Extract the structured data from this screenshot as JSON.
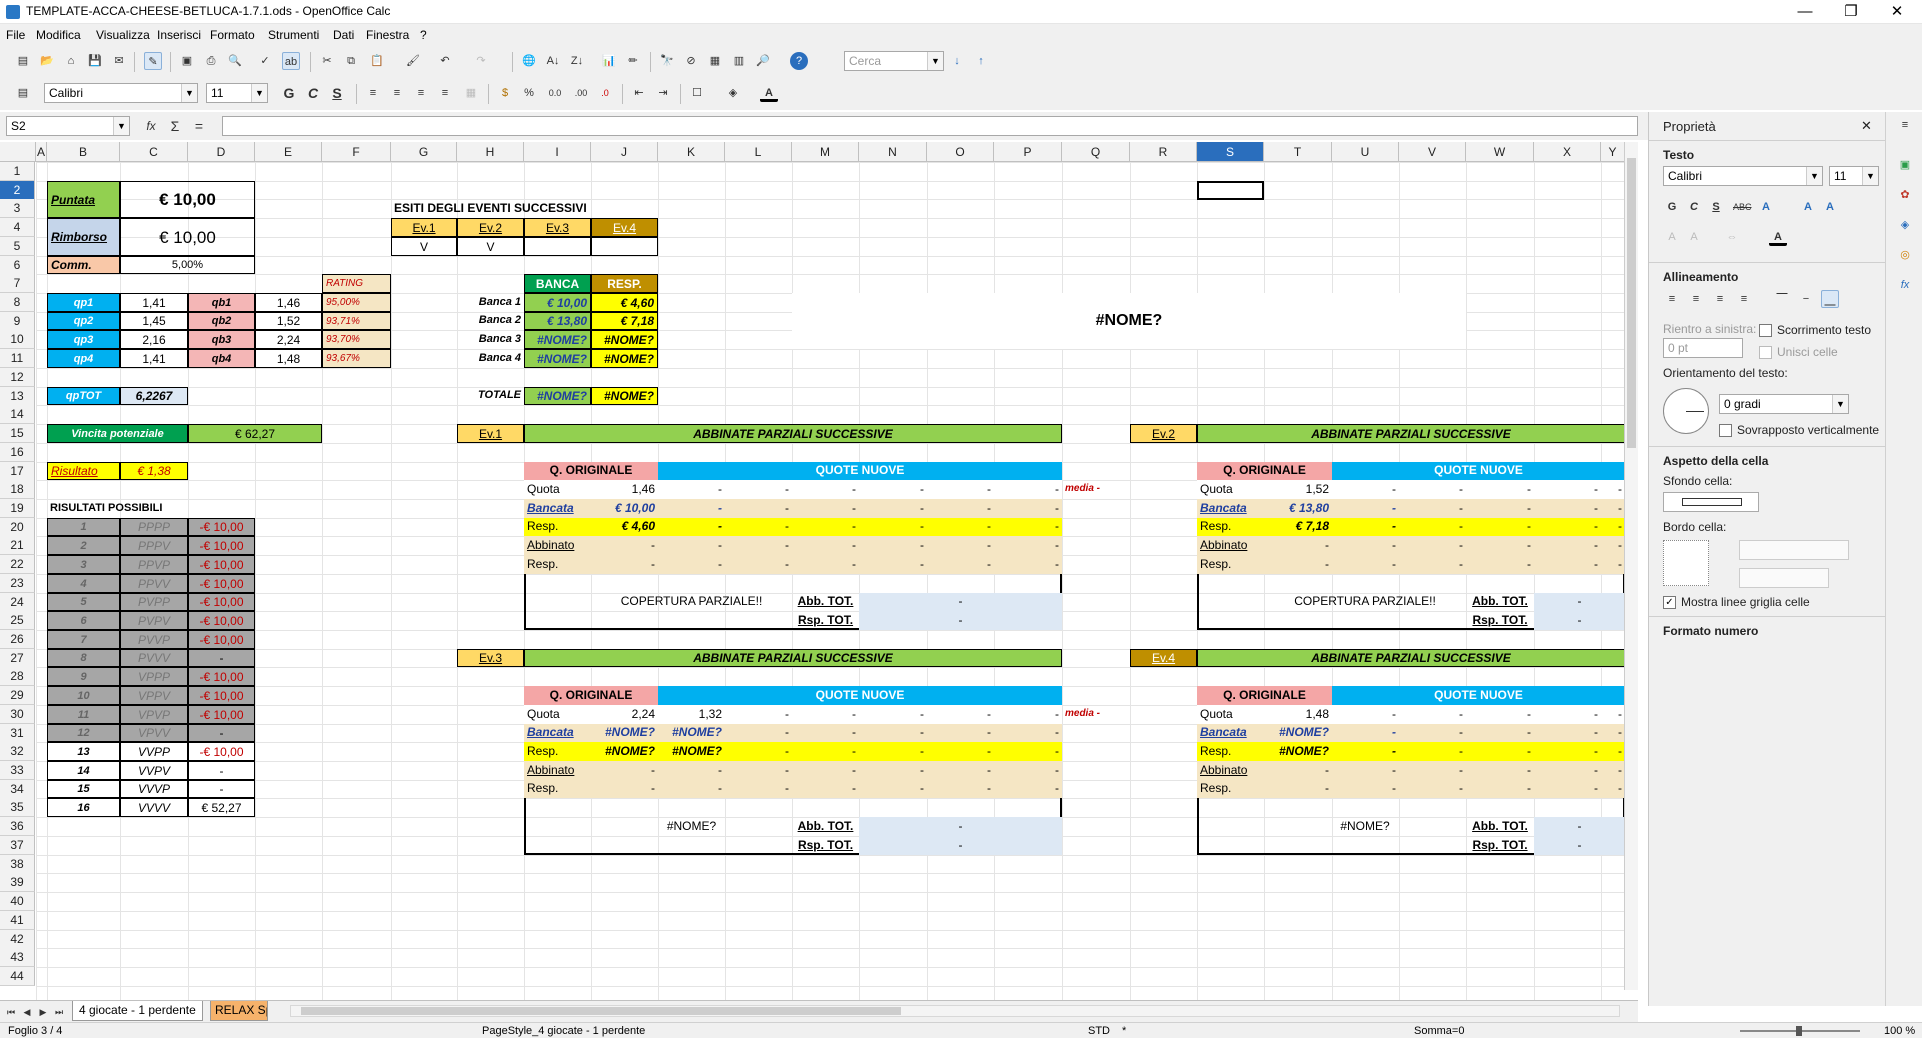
{
  "window": {
    "title": "TEMPLATE-ACCA-CHEESE-BETLUCA-1.7.1.ods - OpenOffice Calc",
    "minimize": "—",
    "restore": "❐",
    "close": "✕"
  },
  "menu": [
    "File",
    "Modifica",
    "Visualizza",
    "Inserisci",
    "Formato",
    "Strumenti",
    "Dati",
    "Finestra",
    "?"
  ],
  "toolbar": {
    "search_placeholder": "Cerca",
    "font_name": "Calibri",
    "font_size": "11",
    "bold": "G",
    "italic": "C",
    "underline": "S"
  },
  "formula": {
    "cell_ref": "S2",
    "value": ""
  },
  "columns": [
    "A",
    "B",
    "C",
    "D",
    "E",
    "F",
    "G",
    "H",
    "I",
    "J",
    "K",
    "L",
    "M",
    "N",
    "O",
    "P",
    "Q",
    "R",
    "S",
    "T",
    "U",
    "V",
    "W",
    "X",
    "Y"
  ],
  "rows": [
    "1",
    "2",
    "3",
    "4",
    "5",
    "6",
    "7",
    "8",
    "9",
    "10",
    "11",
    "12",
    "13",
    "14",
    "15",
    "16",
    "17",
    "18",
    "19",
    "20",
    "21",
    "22",
    "23",
    "24",
    "25",
    "26",
    "27",
    "28",
    "29",
    "30",
    "31",
    "32",
    "33",
    "34",
    "35",
    "36",
    "37",
    "38",
    "39",
    "40",
    "41",
    "42",
    "43",
    "44"
  ],
  "sheet": {
    "puntata_label": "Puntata",
    "puntata_value": "€ 10,00",
    "rimborso_label": "Rimborso",
    "rimborso_value": "€ 10,00",
    "comm_label": "Comm.",
    "comm_value": "5,00%",
    "rating_header": "RATING",
    "qp": [
      {
        "label": "qp1",
        "value": "1,41"
      },
      {
        "label": "qp2",
        "value": "1,45"
      },
      {
        "label": "qp3",
        "value": "2,16"
      },
      {
        "label": "qp4",
        "value": "1,41"
      }
    ],
    "qb": [
      {
        "label": "qb1",
        "value": "1,46"
      },
      {
        "label": "qb2",
        "value": "1,52"
      },
      {
        "label": "qb3",
        "value": "2,24"
      },
      {
        "label": "qb4",
        "value": "1,48"
      }
    ],
    "rating": [
      "95,00%",
      "93,71%",
      "93,70%",
      "93,67%"
    ],
    "qptot_label": "qpTOT",
    "qptot_value": "6,2267",
    "vincita_label": "Vincita potenziale",
    "vincita_value": "€ 62,27",
    "risultato_label": "Risultato",
    "risultato_value": "€ 1,38",
    "risultati_header": "RISULTATI POSSIBILI",
    "risultati": [
      {
        "n": "1",
        "code": "PPPP",
        "value": "-€ 10,00"
      },
      {
        "n": "2",
        "code": "PPPV",
        "value": "-€ 10,00"
      },
      {
        "n": "3",
        "code": "PPVP",
        "value": "-€ 10,00"
      },
      {
        "n": "4",
        "code": "PPVV",
        "value": "-€ 10,00"
      },
      {
        "n": "5",
        "code": "PVPP",
        "value": "-€ 10,00"
      },
      {
        "n": "6",
        "code": "PVPV",
        "value": "-€ 10,00"
      },
      {
        "n": "7",
        "code": "PVVP",
        "value": "-€ 10,00"
      },
      {
        "n": "8",
        "code": "PVVV",
        "value": "-"
      },
      {
        "n": "9",
        "code": "VPPP",
        "value": "-€ 10,00"
      },
      {
        "n": "10",
        "code": "VPPV",
        "value": "-€ 10,00"
      },
      {
        "n": "11",
        "code": "VPVP",
        "value": "-€ 10,00"
      },
      {
        "n": "12",
        "code": "VPVV",
        "value": "-"
      },
      {
        "n": "13",
        "code": "VVPP",
        "value": "-€ 10,00"
      },
      {
        "n": "14",
        "code": "VVPV",
        "value": "-"
      },
      {
        "n": "15",
        "code": "VVVP",
        "value": "-"
      },
      {
        "n": "16",
        "code": "VVVV",
        "value": "€ 52,27"
      }
    ],
    "esiti_header": "ESITI DEGLI EVENTI SUCCESSIVI",
    "esiti": [
      {
        "label": "Ev.1",
        "value": "V"
      },
      {
        "label": "Ev.2",
        "value": "V"
      },
      {
        "label": "Ev.3",
        "value": ""
      },
      {
        "label": "Ev.4",
        "value": ""
      }
    ],
    "banca_header": "BANCA",
    "resp_header": "RESP.",
    "banche": [
      {
        "label": "Banca 1",
        "banca": "€ 10,00",
        "resp": "€ 4,60"
      },
      {
        "label": "Banca 2",
        "banca": "€ 13,80",
        "resp": "€ 7,18"
      },
      {
        "label": "Banca 3",
        "banca": "#NOME?",
        "resp": "#NOME?"
      },
      {
        "label": "Banca 4",
        "banca": "#NOME?",
        "resp": "#NOME?"
      }
    ],
    "totale_label": "TOTALE",
    "totale_banca": "#NOME?",
    "totale_resp": "#NOME?",
    "nome_big": "#NOME?",
    "panel_title": "ABBINATE PARZIALI SUCCESSIVE",
    "q_originale": "Q. ORIGINALE",
    "quote_nuove": "QUOTE NUOVE",
    "row_labels": [
      "Quota",
      "Bancata",
      "Resp.",
      "Abbinato",
      "Resp."
    ],
    "abb_tot": "Abb. TOT.",
    "rsp_tot": "Rsp. TOT.",
    "media": "media -",
    "dash": "-",
    "panels": [
      {
        "ev": "Ev.1",
        "quota": "1,46",
        "bancata": "€ 10,00",
        "resp": "€ 4,60",
        "quota2": "-",
        "bancata2": "-",
        "resp2": "-",
        "copertura": "COPERTURA PARZIALE!!"
      },
      {
        "ev": "Ev.2",
        "quota": "1,52",
        "bancata": "€ 13,80",
        "resp": "€ 7,18",
        "quota2": "-",
        "bancata2": "-",
        "resp2": "-",
        "copertura": "COPERTURA PARZIALE!!"
      },
      {
        "ev": "Ev.3",
        "quota": "2,24",
        "bancata": "#NOME?",
        "resp": "#NOME?",
        "quota2": "1,32",
        "bancata2": "#NOME?",
        "resp2": "#NOME?",
        "copertura": "#NOME?"
      },
      {
        "ev": "Ev.4",
        "quota": "1,48",
        "bancata": "#NOME?",
        "resp": "#NOME?",
        "quota2": "-",
        "bancata2": "-",
        "resp2": "-",
        "copertura": "#NOME?"
      }
    ]
  },
  "sidebar": {
    "title": "Proprietà",
    "close": "✕",
    "testo": "Testo",
    "font": "Calibri",
    "size": "11",
    "allineamento": "Allineamento",
    "rientro": "Rientro a sinistra:",
    "rientro_value": "0 pt",
    "scorrimento": "Scorrimento testo",
    "unisci": "Unisci celle",
    "orientamento": "Orientamento del testo:",
    "gradi": "0 gradi",
    "sovrapposto": "Sovrapposto verticalmente",
    "aspetto": "Aspetto della cella",
    "sfondo": "Sfondo cella:",
    "bordo": "Bordo cella:",
    "griglia": "Mostra linee griglia celle",
    "formato": "Formato numero"
  },
  "tabs": [
    "4 giocate - 1 perdente",
    "RELAX Sp"
  ],
  "status": {
    "foglio": "Foglio 3 / 4",
    "pagestyle": "PageStyle_4 giocate - 1 perdente",
    "mode": "STD",
    "mod": "*",
    "somma": "Somma=0",
    "zoom": "100 %"
  },
  "colors": {
    "green": "#92d050",
    "blue": "#00b0f0",
    "pink": "#f4b6b6",
    "yellow": "#ffff00",
    "tan": "#f5e6c4",
    "gold": "#ffd966",
    "darkgold": "#bf8f00",
    "gray": "#a6a6a6",
    "salmon": "#f9c8a8",
    "orange": "#f6b26b"
  }
}
